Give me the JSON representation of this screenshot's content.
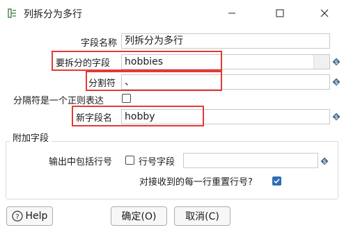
{
  "window": {
    "title": "列拆分为多行",
    "controls": [
      "minimize-icon",
      "maximize-icon",
      "close-icon"
    ]
  },
  "form": {
    "step_name": {
      "label": "字段名称",
      "value": "列拆分为多行"
    },
    "split_field": {
      "label": "要拆分的字段",
      "value": "hobbies"
    },
    "delimiter": {
      "label": "分割符",
      "value": "、"
    },
    "is_regex": {
      "label": "分隔符是一个正则表达",
      "checked": false
    },
    "new_field": {
      "label": "新字段名",
      "value": "hobby"
    }
  },
  "additional": {
    "group_title": "附加字段",
    "include_rownum": {
      "label": "输出中包括行号",
      "checked": false
    },
    "rownum_field": {
      "label": "行号字段",
      "value": ""
    },
    "reset_rownum": {
      "label": "对接收到的每一行重置行号?",
      "checked": true
    }
  },
  "buttons": {
    "help": "Help",
    "ok": "确定(O)",
    "cancel": "取消(C)"
  },
  "colors": {
    "highlight": "#e53935",
    "checkbox_checked": "#2f6db5"
  }
}
